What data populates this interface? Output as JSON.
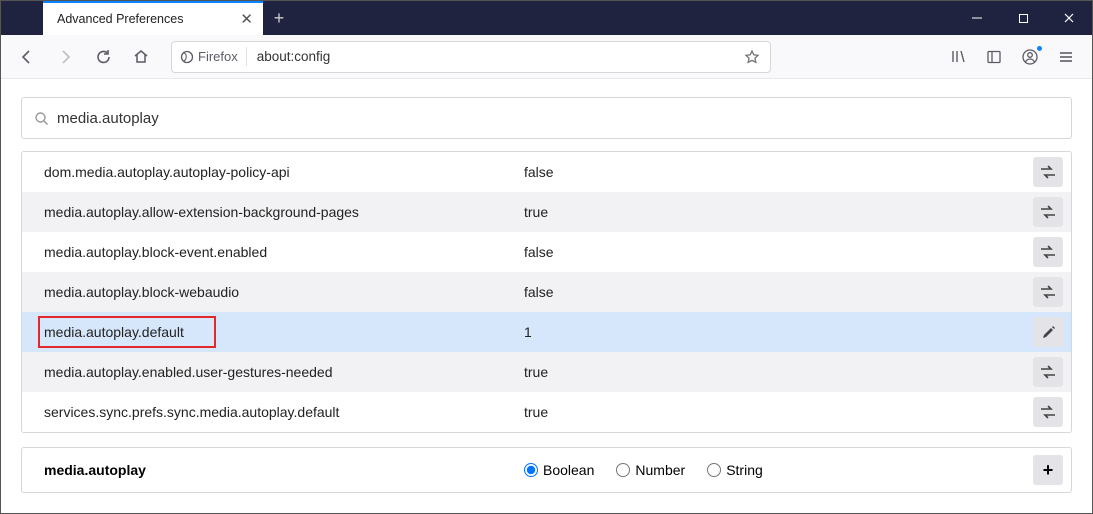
{
  "tab": {
    "title": "Advanced Preferences"
  },
  "urlbar": {
    "identity": "Firefox",
    "url": "about:config"
  },
  "search": {
    "value": "media.autoplay"
  },
  "prefs": [
    {
      "name": "dom.media.autoplay.autoplay-policy-api",
      "value": "false",
      "action": "toggle",
      "alt": false,
      "sel": false
    },
    {
      "name": "media.autoplay.allow-extension-background-pages",
      "value": "true",
      "action": "toggle",
      "alt": true,
      "sel": false
    },
    {
      "name": "media.autoplay.block-event.enabled",
      "value": "false",
      "action": "toggle",
      "alt": false,
      "sel": false
    },
    {
      "name": "media.autoplay.block-webaudio",
      "value": "false",
      "action": "toggle",
      "alt": true,
      "sel": false
    },
    {
      "name": "media.autoplay.default",
      "value": "1",
      "action": "edit",
      "alt": false,
      "sel": true,
      "highlight": true
    },
    {
      "name": "media.autoplay.enabled.user-gestures-needed",
      "value": "true",
      "action": "toggle",
      "alt": true,
      "sel": false
    },
    {
      "name": "services.sync.prefs.sync.media.autoplay.default",
      "value": "true",
      "action": "toggle",
      "alt": false,
      "sel": false
    }
  ],
  "newpref": {
    "name": "media.autoplay",
    "types": {
      "boolean": "Boolean",
      "number": "Number",
      "string": "String"
    },
    "selected": "boolean"
  }
}
